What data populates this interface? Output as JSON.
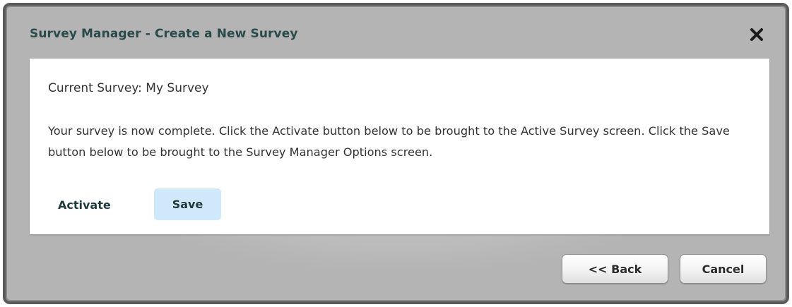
{
  "dialog": {
    "title": "Survey Manager - Create a New Survey",
    "close_icon": "close-icon"
  },
  "content": {
    "current_survey": "Current Survey: My Survey",
    "message": "Your survey is now complete. Click the Activate button below to be brought to the Active Survey screen. Click the Save button below to be brought to the Survey Manager Options screen.",
    "activate_label": "Activate",
    "save_label": "Save"
  },
  "footer": {
    "back_label": "<< Back",
    "cancel_label": "Cancel"
  },
  "colors": {
    "title_text": "#2a4a4a",
    "save_highlight": "#cfe9fa",
    "frame_border": "#5a5a5a"
  }
}
